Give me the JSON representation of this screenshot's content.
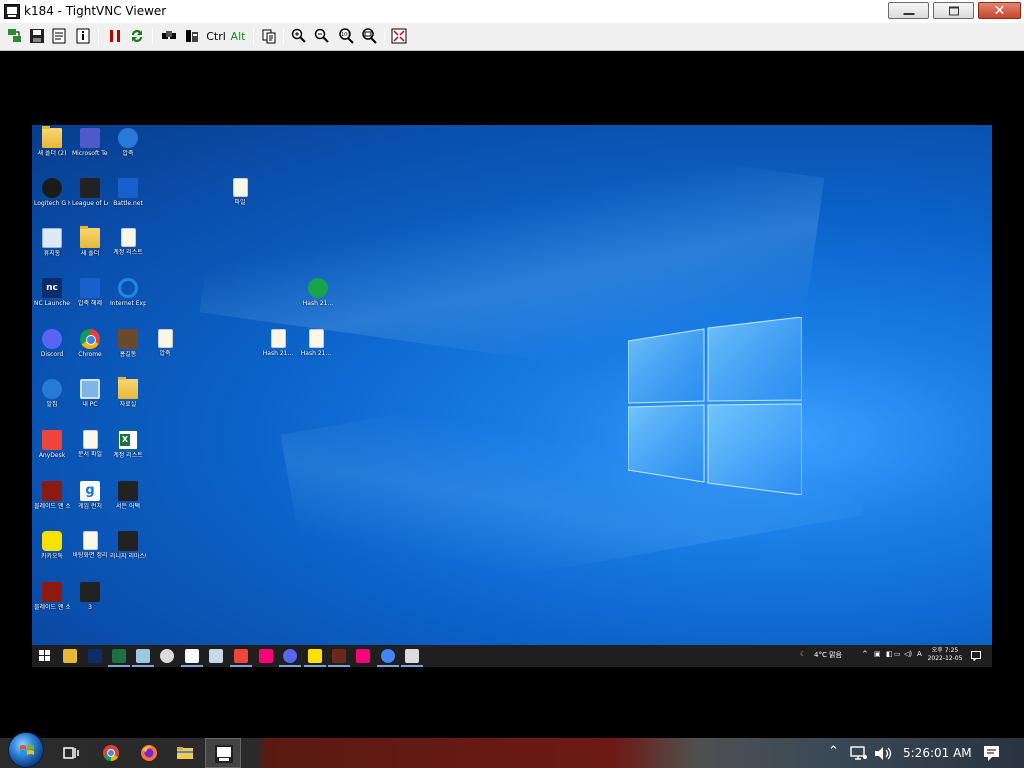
{
  "window": {
    "title": "k184 - TightVNC Viewer",
    "close_glyph": "✕"
  },
  "toolbar": {
    "ctrl_label": "Ctrl",
    "alt_label": "Alt",
    "icons": [
      "new-connection-icon",
      "save-icon",
      "options-icon",
      "info-icon",
      "pause-icon",
      "refresh-icon",
      "ctrl-alt-del-icon",
      "ctrl-esc-icon",
      "ctrl-key",
      "alt-key",
      "clipboard-icon",
      "zoom-in-icon",
      "zoom-out-icon",
      "zoom-100-icon",
      "zoom-fit-icon",
      "fullscreen-icon"
    ]
  },
  "desktop": {
    "icons": [
      {
        "label": "새 폴더 (2)",
        "type": "folder"
      },
      {
        "label": "Microsoft Teams",
        "type": "teams"
      },
      {
        "label": "압축",
        "type": "zip"
      },
      {
        "label": "Logitech G HUB",
        "type": "dark"
      },
      {
        "label": "League of Legends",
        "type": "game"
      },
      {
        "label": "Battle.net",
        "type": "blue"
      },
      {
        "label": "휴지통",
        "type": "recycle"
      },
      {
        "label": "새 폴더",
        "type": "folder"
      },
      {
        "label": "계정 리스트",
        "type": "file"
      },
      {
        "label": "NC Launcher 2",
        "type": "nc"
      },
      {
        "label": "압축 해제",
        "type": "blue"
      },
      {
        "label": "Internet Explorer",
        "type": "ie"
      },
      {
        "label": "Discord",
        "type": "discord"
      },
      {
        "label": "Chrome",
        "type": "chrome"
      },
      {
        "label": "홍길동",
        "type": "person"
      },
      {
        "label": "압축",
        "type": "file"
      },
      {
        "label": "알집",
        "type": "zip"
      },
      {
        "label": "내 PC",
        "type": "pc"
      },
      {
        "label": "자료실",
        "type": "folder"
      },
      {
        "label": "AnyDesk",
        "type": "anydesk"
      },
      {
        "label": "문서 파일",
        "type": "file"
      },
      {
        "label": "계정 리스트",
        "type": "excel"
      },
      {
        "label": "블레이드 앤 소울",
        "type": "red"
      },
      {
        "label": "게임 런처",
        "type": "g"
      },
      {
        "label": "서든 어택",
        "type": "game"
      },
      {
        "label": "카카오톡",
        "type": "talk"
      },
      {
        "label": "바탕화면 정리",
        "type": "file"
      },
      {
        "label": "리니지 리마스터",
        "type": "game"
      },
      {
        "label": "블레이드 앤 소울",
        "type": "red"
      },
      {
        "label": "3",
        "type": "game"
      },
      {
        "label": "파일",
        "type": "file"
      },
      {
        "label": "Hash 21...",
        "type": "tz"
      },
      {
        "label": "Hash 21...",
        "type": "file"
      },
      {
        "label": "Hash 21...",
        "type": "file"
      }
    ]
  },
  "remote_taskbar": {
    "weather": "4°C 맑음",
    "ime": "A",
    "time": "오후 7:25",
    "date": "2022-12-05"
  },
  "host_taskbar": {
    "clock": "5:26:01 AM",
    "apps": [
      "task-view-icon",
      "chrome-icon",
      "firefox-icon",
      "explorer-icon",
      "tightvnc-icon"
    ]
  },
  "colors": {
    "accent": "#0078d7",
    "desktop": "#0b63c9",
    "titlebar": "#ffffff",
    "close_button": "#c6452d"
  }
}
